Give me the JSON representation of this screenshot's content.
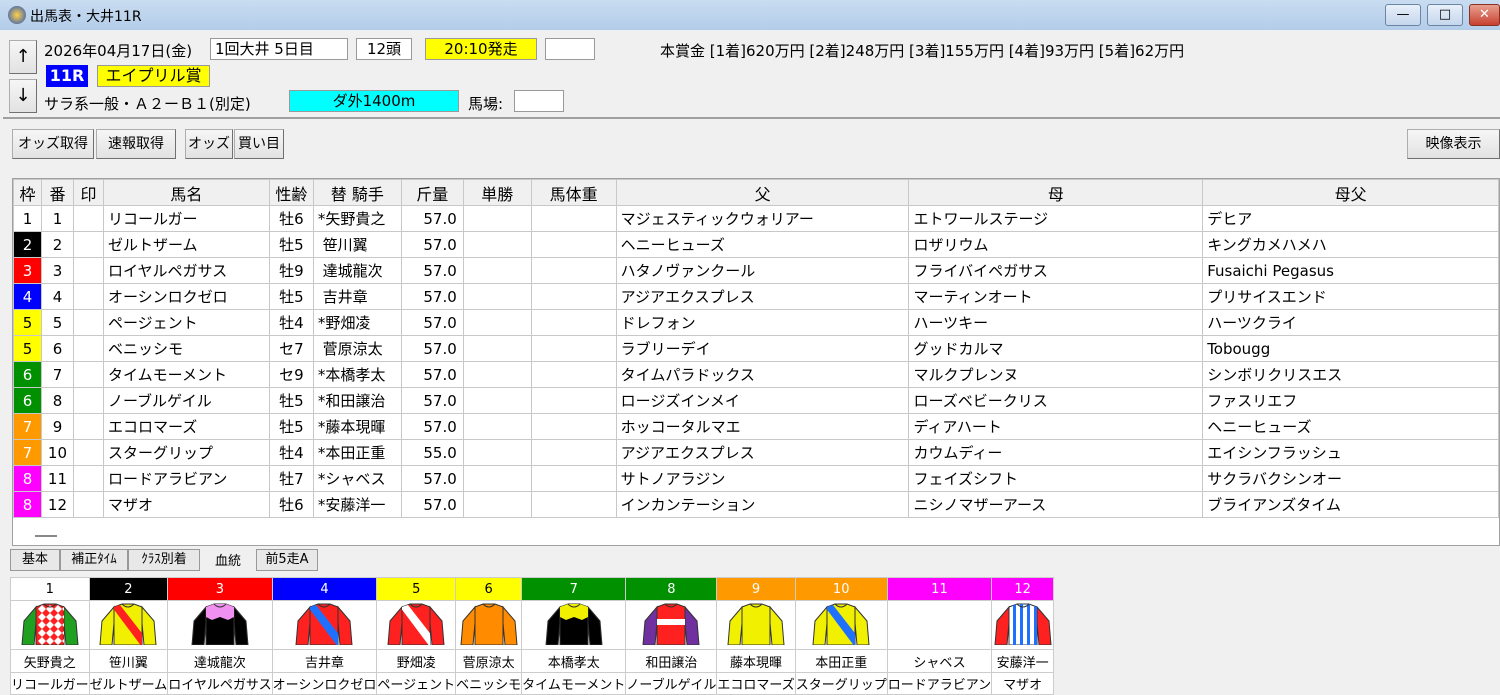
{
  "window": {
    "title": "出馬表・大井11R",
    "minimize": "—",
    "maximize": "□",
    "close": "✕"
  },
  "race": {
    "date": "2026年04月17日(金)",
    "meeting": "1回大井 5日目",
    "runners": "12頭",
    "post_time": "20:10発走",
    "blank": "",
    "race_no": "11R",
    "race_name": "エイプリル賞",
    "class": "サラ系一般・Ａ２ーＢ１(別定)",
    "course": "ダ外1400m",
    "track_label": "馬場:",
    "track_value": "",
    "prize": "本賞金 [1着]620万円 [2着]248万円 [3着]155万円 [4着]93万円 [5着]62万円"
  },
  "nav": {
    "up": "↑",
    "down": "↓"
  },
  "toolbar": {
    "odds_fetch": "オッズ取得",
    "flash_fetch": "速報取得",
    "odds": "オッズ",
    "buy": "買い目",
    "video": "映像表示"
  },
  "colors": {
    "frame": {
      "1": "#ffffff",
      "2": "#000000",
      "3": "#ff0000",
      "4": "#0000ff",
      "5": "#ffff00",
      "6": "#009000",
      "7": "#ff9900",
      "8": "#ff00ff"
    },
    "post_time_bg": "#ffff00",
    "race_no_bg": "#0000ff",
    "course_bg": "#00ffff"
  },
  "table": {
    "headers": [
      "枠",
      "番",
      "印",
      "馬名",
      "性齢",
      "替 騎手",
      "斤量",
      "単勝",
      "馬体重",
      "父",
      "母",
      "母父"
    ],
    "rows": [
      {
        "waku": "1",
        "num": "1",
        "mark": "",
        "name": "リコールガー",
        "sexage": "牡6",
        "jockey": "*矢野貴之",
        "weight": "57.0",
        "odds": "",
        "bw": "",
        "sire": "マジェスティックウォリアー",
        "dam": "エトワールステージ",
        "bms": "デヒア"
      },
      {
        "waku": "2",
        "num": "2",
        "mark": "",
        "name": "ゼルトザーム",
        "sexage": "牡5",
        "jockey": " 笹川翼",
        "weight": "57.0",
        "odds": "",
        "bw": "",
        "sire": "ヘニーヒューズ",
        "dam": "ロザリウム",
        "bms": "キングカメハメハ"
      },
      {
        "waku": "3",
        "num": "3",
        "mark": "",
        "name": "ロイヤルペガサス",
        "sexage": "牡9",
        "jockey": " 達城龍次",
        "weight": "57.0",
        "odds": "",
        "bw": "",
        "sire": "ハタノヴァンクール",
        "dam": "フライバイペガサス",
        "bms": "Fusaichi Pegasus"
      },
      {
        "waku": "4",
        "num": "4",
        "mark": "",
        "name": "オーシンロクゼロ",
        "sexage": "牡5",
        "jockey": " 吉井章",
        "weight": "57.0",
        "odds": "",
        "bw": "",
        "sire": "アジアエクスプレス",
        "dam": "マーティンオート",
        "bms": "プリサイスエンド"
      },
      {
        "waku": "5",
        "num": "5",
        "mark": "",
        "name": "ページェント",
        "sexage": "牡4",
        "jockey": "*野畑凌",
        "weight": "57.0",
        "odds": "",
        "bw": "",
        "sire": "ドレフォン",
        "dam": "ハーツキー",
        "bms": "ハーツクライ"
      },
      {
        "waku": "5",
        "num": "6",
        "mark": "",
        "name": "ベニッシモ",
        "sexage": "セ7",
        "jockey": " 菅原涼太",
        "weight": "57.0",
        "odds": "",
        "bw": "",
        "sire": "ラブリーデイ",
        "dam": "グッドカルマ",
        "bms": "Tobougg"
      },
      {
        "waku": "6",
        "num": "7",
        "mark": "",
        "name": "タイムモーメント",
        "sexage": "セ9",
        "jockey": "*本橋孝太",
        "weight": "57.0",
        "odds": "",
        "bw": "",
        "sire": "タイムパラドックス",
        "dam": "マルクプレンヌ",
        "bms": "シンボリクリスエス"
      },
      {
        "waku": "6",
        "num": "8",
        "mark": "",
        "name": "ノーブルゲイル",
        "sexage": "牡5",
        "jockey": "*和田譲治",
        "weight": "57.0",
        "odds": "",
        "bw": "",
        "sire": "ロージズインメイ",
        "dam": "ローズベビークリス",
        "bms": "ファスリエフ"
      },
      {
        "waku": "7",
        "num": "9",
        "mark": "",
        "name": "エコロマーズ",
        "sexage": "牡5",
        "jockey": "*藤本現暉",
        "weight": "57.0",
        "odds": "",
        "bw": "",
        "sire": "ホッコータルマエ",
        "dam": "ディアハート",
        "bms": "ヘニーヒューズ"
      },
      {
        "waku": "7",
        "num": "10",
        "mark": "",
        "name": "スターグリップ",
        "sexage": "牡4",
        "jockey": "*本田正重",
        "weight": "55.0",
        "odds": "",
        "bw": "",
        "sire": "アジアエクスプレス",
        "dam": "カウムディー",
        "bms": "エイシンフラッシュ"
      },
      {
        "waku": "8",
        "num": "11",
        "mark": "",
        "name": "ロードアラビアン",
        "sexage": "牡7",
        "jockey": "*シャベス",
        "weight": "57.0",
        "odds": "",
        "bw": "",
        "sire": "サトノアラジン",
        "dam": "フェイズシフト",
        "bms": "サクラバクシンオー"
      },
      {
        "waku": "8",
        "num": "12",
        "mark": "",
        "name": "マザオ",
        "sexage": "牡6",
        "jockey": "*安藤洋一",
        "weight": "57.0",
        "odds": "",
        "bw": "",
        "sire": "インカンテーション",
        "dam": "ニシノマザーアース",
        "bms": "ブライアンズタイム"
      }
    ]
  },
  "tabs": [
    "基本",
    "補正ﾀｲﾑ",
    "ｸﾗｽ別着",
    "血統",
    "前5走A"
  ],
  "active_tab": "血統",
  "silks": [
    {
      "num": "1",
      "waku": "1",
      "jockey": "矢野貴之",
      "horse": "リコールガー",
      "body": "#ff2020",
      "sleeve": "#20a020",
      "pattern": "diamonds",
      "accent": "#ffffff"
    },
    {
      "num": "2",
      "waku": "2",
      "jockey": "笹川翼",
      "horse": "ゼルトザーム",
      "body": "#f0f000",
      "sleeve": "#f0f000",
      "pattern": "sash",
      "accent": "#ff2020"
    },
    {
      "num": "3",
      "waku": "3",
      "jockey": "達城龍次",
      "horse": "ロイヤルペガサス",
      "body": "#000000",
      "sleeve": "#000000",
      "pattern": "yoke",
      "accent": "#f090f0"
    },
    {
      "num": "4",
      "waku": "4",
      "jockey": "吉井章",
      "horse": "オーシンロクゼロ",
      "body": "#ff2020",
      "sleeve": "#ff2020",
      "pattern": "sash",
      "accent": "#2070ff"
    },
    {
      "num": "5",
      "waku": "5",
      "jockey": "野畑凌",
      "horse": "ページェント",
      "body": "#ff2020",
      "sleeve": "#ff2020",
      "pattern": "sash",
      "accent": "#ffffff"
    },
    {
      "num": "6",
      "waku": "5",
      "jockey": "菅原涼太",
      "horse": "ベニッシモ",
      "body": "#ff8c00",
      "sleeve": "#ff8c00",
      "pattern": "plain",
      "accent": "#ffffff"
    },
    {
      "num": "7",
      "waku": "6",
      "jockey": "本橋孝太",
      "horse": "タイムモーメント",
      "body": "#000000",
      "sleeve": "#000000",
      "pattern": "yoke",
      "accent": "#f0f000"
    },
    {
      "num": "8",
      "waku": "6",
      "jockey": "和田譲治",
      "horse": "ノーブルゲイル",
      "body": "#ff2020",
      "sleeve": "#7030a0",
      "pattern": "band",
      "accent": "#ffffff"
    },
    {
      "num": "9",
      "waku": "7",
      "jockey": "藤本現暉",
      "horse": "エコロマーズ",
      "body": "#f0f000",
      "sleeve": "#f0f000",
      "pattern": "check",
      "accent": "#ffffff"
    },
    {
      "num": "10",
      "waku": "7",
      "jockey": "本田正重",
      "horse": "スターグリップ",
      "body": "#f0f000",
      "sleeve": "#f0f000",
      "pattern": "sash",
      "accent": "#2070ff"
    },
    {
      "num": "11",
      "waku": "8",
      "jockey": "シャベス",
      "horse": "ロードアラビアン",
      "body": "",
      "sleeve": "",
      "pattern": "none",
      "accent": ""
    },
    {
      "num": "12",
      "waku": "8",
      "jockey": "安藤洋一",
      "horse": "マザオ",
      "body": "#ffffff",
      "sleeve": "#ff2020",
      "pattern": "stripes",
      "accent": "#2070ff"
    }
  ]
}
